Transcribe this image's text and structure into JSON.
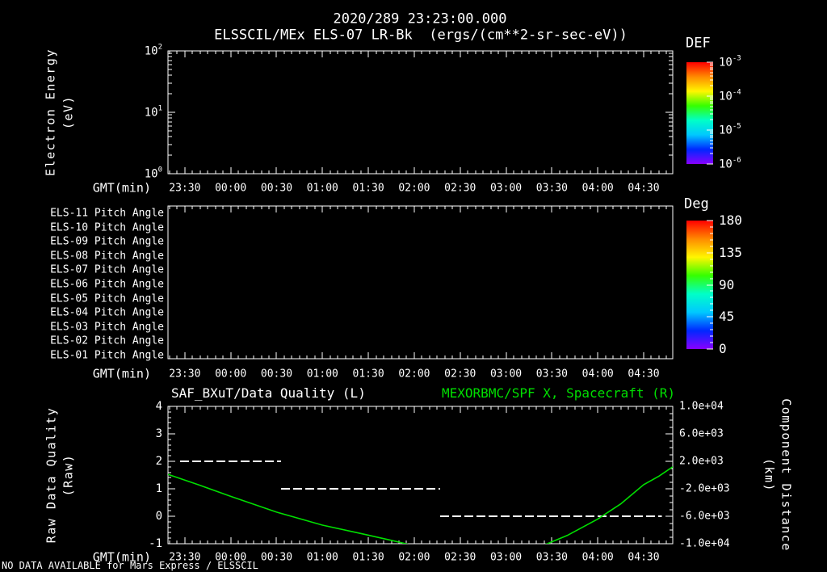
{
  "header": {
    "title": "2020/289 23:23:00.000",
    "subtitle": "ELSSCIL/MEx ELS-07 LR-Bk  (ergs/(cm**2-sr-sec-eV))"
  },
  "x_axis": {
    "label": "GMT(min)",
    "domain_t": [
      19,
      349
    ],
    "ticks": [
      {
        "t": 30,
        "label": "23:30"
      },
      {
        "t": 60,
        "label": "00:00"
      },
      {
        "t": 90,
        "label": "00:30"
      },
      {
        "t": 120,
        "label": "01:00"
      },
      {
        "t": 150,
        "label": "01:30"
      },
      {
        "t": 180,
        "label": "02:00"
      },
      {
        "t": 210,
        "label": "02:30"
      },
      {
        "t": 240,
        "label": "03:00"
      },
      {
        "t": 270,
        "label": "03:30"
      },
      {
        "t": 300,
        "label": "04:00"
      },
      {
        "t": 330,
        "label": "04:30"
      }
    ]
  },
  "colors": {
    "background": "#000000",
    "foreground": "#ffffff",
    "green": "#00df00",
    "rainbow": [
      "#ff0000",
      "#ff8a00",
      "#fff600",
      "#35ff00",
      "#00ffc8",
      "#00c8ff",
      "#0028ff",
      "#8800ff"
    ]
  },
  "chart_data": [
    {
      "type": "heatmap",
      "name": "electron-energy-spectrogram",
      "ylabel": "Electron Energy",
      "ylabel_units": "(eV)",
      "y_scale": "log",
      "y_tick_exponents": [
        0,
        1,
        2
      ],
      "y_range_ev": [
        1,
        100
      ],
      "colorbar": {
        "label": "DEF",
        "tick_exponents": [
          -3,
          -4,
          -5,
          -6
        ]
      },
      "values": []
    },
    {
      "type": "heatmap",
      "name": "pitch-angle-rows",
      "rows": [
        "ELS-11 Pitch Angle",
        "ELS-10 Pitch Angle",
        "ELS-09 Pitch Angle",
        "ELS-08 Pitch Angle",
        "ELS-07 Pitch Angle",
        "ELS-06 Pitch Angle",
        "ELS-05 Pitch Angle",
        "ELS-04 Pitch Angle",
        "ELS-03 Pitch Angle",
        "ELS-02 Pitch Angle",
        "ELS-01 Pitch Angle"
      ],
      "colorbar": {
        "label": "Deg",
        "ticks": [
          180,
          135,
          90,
          45,
          0
        ]
      },
      "values": []
    },
    {
      "type": "line",
      "name": "quality-and-spacecraft",
      "title_left": "SAF_BXuT/Data Quality (L)",
      "title_right": "MEXORBMC/SPF X, Spacecraft (R)",
      "ylabel_left": "Raw Data Quality",
      "ylabel_left_units": "(Raw)",
      "ylabel_right": "Component Distance",
      "ylabel_right_units": "(km)",
      "y_left_ticks": [
        4,
        3,
        2,
        1,
        0,
        -1
      ],
      "y_left_range": [
        -1,
        4
      ],
      "y_right_ticks": [
        "1.0e+04",
        "6.0e+03",
        "2.0e+03",
        "-2.0e+03",
        "-6.0e+03",
        "-1.0e+04"
      ],
      "y_right_range": [
        -10000,
        10000
      ],
      "series": [
        {
          "name": "SAF_BXuT/Data Quality (L)",
          "axis": "left",
          "style": "dashed",
          "color": "#ffffff",
          "segments": [
            {
              "value": 2,
              "t": [
                27,
                93
              ]
            },
            {
              "value": 1,
              "t": [
                93,
                197
              ]
            },
            {
              "value": 0,
              "t": [
                197,
                342
              ]
            }
          ]
        },
        {
          "name": "MEXORBMC/SPF X, Spacecraft (R)",
          "axis": "right",
          "style": "solid",
          "color": "#00df00",
          "points": [
            [
              19,
              100
            ],
            [
              40,
              -1500
            ],
            [
              60,
              -3100
            ],
            [
              90,
              -5400
            ],
            [
              120,
              -7300
            ],
            [
              145,
              -8500
            ],
            [
              165,
              -9500
            ],
            [
              180,
              -10300
            ],
            [
              200,
              -11300
            ],
            [
              220,
              -11800
            ],
            [
              240,
              -11400
            ],
            [
              255,
              -10700
            ],
            [
              267,
              -10000
            ],
            [
              280,
              -8800
            ],
            [
              300,
              -6400
            ],
            [
              315,
              -4200
            ],
            [
              330,
              -1400
            ],
            [
              340,
              -150
            ],
            [
              349,
              1200
            ]
          ]
        }
      ]
    }
  ],
  "footer": {
    "message": "NO DATA AVAILABLE for Mars Express / ELSSCIL"
  }
}
